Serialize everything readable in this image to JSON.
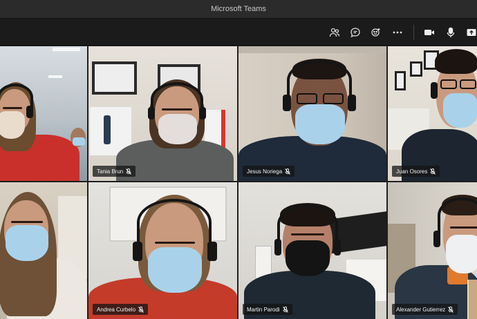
{
  "window": {
    "title": "Microsoft Teams"
  },
  "toolbar": {
    "buttons": [
      {
        "name": "participants-icon"
      },
      {
        "name": "chat-icon"
      },
      {
        "name": "reactions-icon"
      },
      {
        "name": "more-options-icon"
      },
      {
        "name": "camera-icon"
      },
      {
        "name": "microphone-icon"
      },
      {
        "name": "share-screen-icon"
      }
    ]
  },
  "participants": [
    {
      "name": ""
    },
    {
      "name": "Tania Brun",
      "muted": true
    },
    {
      "name": "Jesus Noriega",
      "muted": true
    },
    {
      "name": "Juan Osores",
      "muted": true
    },
    {
      "name": ""
    },
    {
      "name": "Andrea Curbelo",
      "muted": true
    },
    {
      "name": "Martin Parodi",
      "muted": true
    },
    {
      "name": "Alexander Gutierrez",
      "muted": true
    }
  ],
  "colors": {
    "titlebar": "#2b2b2b",
    "toolbar": "#1b1b1b",
    "mask": "#a9d2ea"
  }
}
